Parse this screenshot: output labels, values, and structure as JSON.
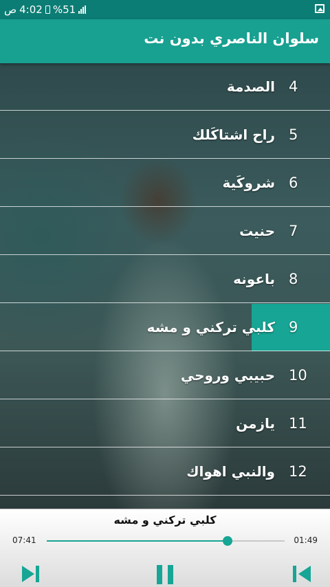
{
  "status": {
    "carrier": "ص",
    "time": "4:02",
    "battery": "%51",
    "signal": "signal-bars"
  },
  "app": {
    "title": "سلوان الناصري بدون نت"
  },
  "songs": [
    {
      "num": "4",
      "name": "الصدمة"
    },
    {
      "num": "5",
      "name": "راح اشتاكَلك"
    },
    {
      "num": "6",
      "name": "شروكَية"
    },
    {
      "num": "7",
      "name": "حنيت"
    },
    {
      "num": "8",
      "name": "باعونه"
    },
    {
      "num": "9",
      "name": "كلبي تركني و مشه",
      "active": true
    },
    {
      "num": "10",
      "name": "حبيبي وروحي"
    },
    {
      "num": "11",
      "name": "يازمن"
    },
    {
      "num": "12",
      "name": "والنبي اهواك"
    }
  ],
  "player": {
    "song_title": "كلبي تركني و مشه",
    "elapsed": "07:41",
    "remaining": "01:49",
    "progress": 0.76
  },
  "colors": {
    "primary": "#18a091",
    "statusbar": "#0c7d74",
    "accent": "#17a595"
  }
}
